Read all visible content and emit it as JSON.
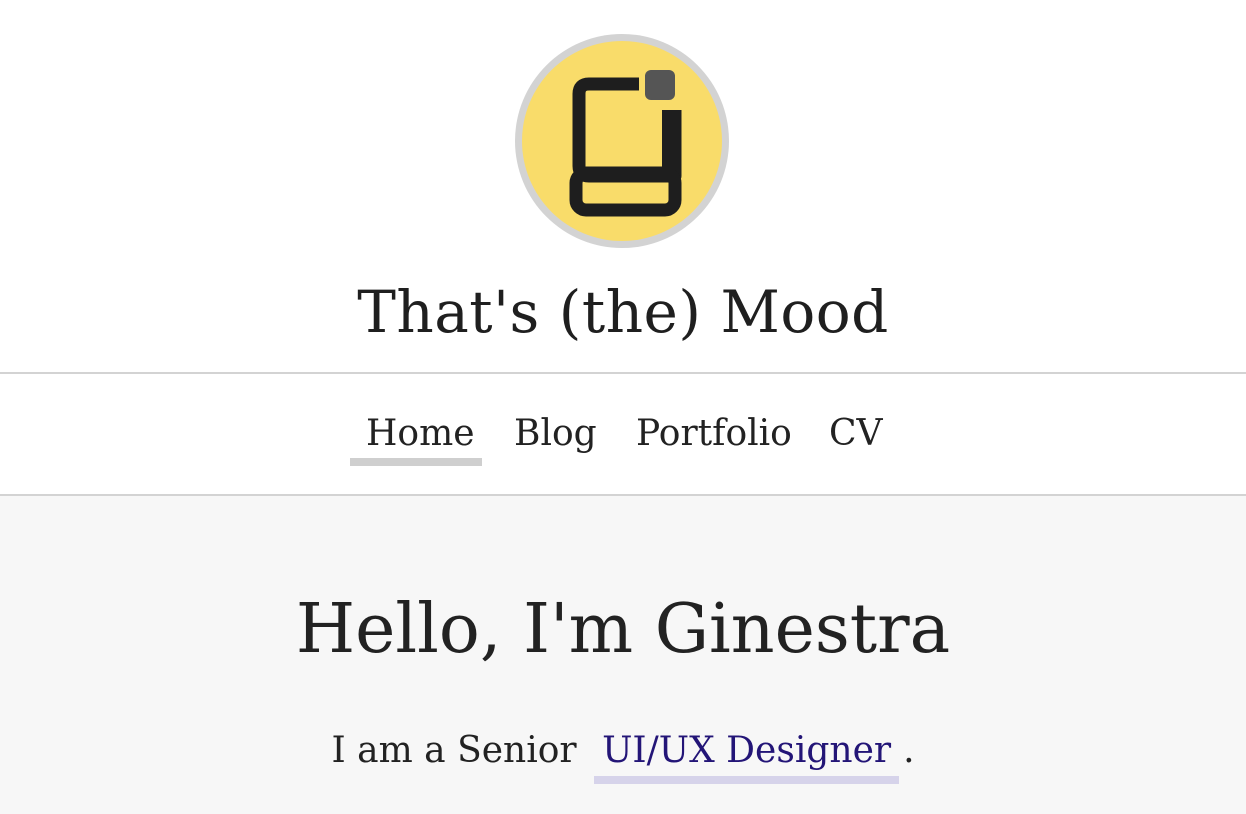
{
  "site": {
    "title": "That's (the) Mood",
    "logo": {
      "icon": "g-monogram-logo",
      "ring_color": "#d3d3d3",
      "fill_color": "#f9dc6a",
      "glyph_color": "#1e1e1e",
      "accent_color": "#555555"
    }
  },
  "nav": {
    "items": [
      {
        "label": "Home",
        "active": true
      },
      {
        "label": "Blog",
        "active": false
      },
      {
        "label": "Portfolio",
        "active": false
      },
      {
        "label": "CV",
        "active": false
      }
    ]
  },
  "hero": {
    "title": "Hello, I'm Ginestra",
    "intro_prefix": "I am a Senior",
    "role_link": "UI/UX Designer",
    "intro_suffix": "."
  },
  "colors": {
    "link": "#231577",
    "link_underline": "#d6d3ea",
    "active_underline": "#cfcfcf",
    "content_background": "#f7f7f7",
    "rule": "#d3d3d3"
  }
}
